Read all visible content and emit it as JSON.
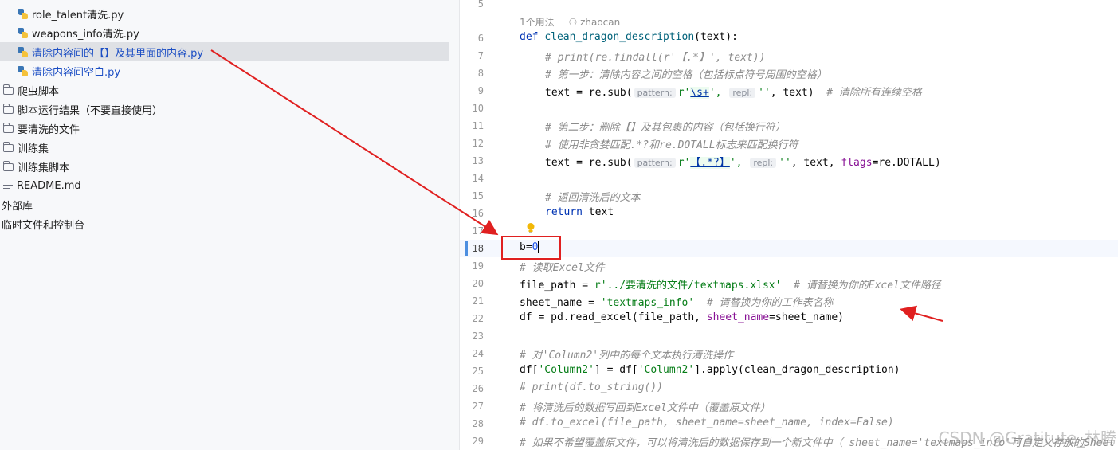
{
  "project_tree": {
    "files_top": [
      {
        "label": "role_talent清洗.py",
        "type": "python"
      },
      {
        "label": "weapons_info清洗.py",
        "type": "python"
      },
      {
        "label": "清除内容间的【】及其里面的内容.py",
        "type": "python",
        "selected": true
      },
      {
        "label": "清除内容间空白.py",
        "type": "python"
      }
    ],
    "folders": [
      {
        "label": "爬虫脚本"
      },
      {
        "label": "脚本运行结果（不要直接使用）"
      },
      {
        "label": "要清洗的文件"
      },
      {
        "label": "训练集"
      },
      {
        "label": "训练集脚本"
      }
    ],
    "readme": "README.md",
    "external_libs": "外部库",
    "scratches": "临时文件和控制台"
  },
  "editor": {
    "usage_hint": "1个用法",
    "author_hint": "zhaocan",
    "line_numbers": [
      "5",
      "6",
      "7",
      "8",
      "9",
      "10",
      "11",
      "12",
      "13",
      "14",
      "15",
      "16",
      "17",
      "18",
      "19",
      "20",
      "21",
      "22",
      "23",
      "24",
      "25",
      "26",
      "27",
      "28",
      "29"
    ],
    "current_line": "18",
    "hints": {
      "pattern": "pattern:",
      "repl": "repl:"
    },
    "code": {
      "l6_def": "def",
      "l6_name": "clean_dragon_description",
      "l6_rest": "(text):",
      "l7": "# print(re.findall(r'【.*】', text))",
      "l8": "# 第一步：清除内容之间的空格（包括标点符号周围的空格）",
      "l9_a": "text = re.sub(",
      "l9_s1a": "r'",
      "l9_rx": "\\s+",
      "l9_s1b": "',",
      "l9_s2": "''",
      "l9_b": ", text)",
      "l9_cm": "# 清除所有连续空格",
      "l11": "# 第二步：删除【】及其包裹的内容（包括换行符）",
      "l12": "# 使用非贪婪匹配.*?和re.DOTALL标志来匹配换行符",
      "l13_a": "text = re.sub(",
      "l13_s1a": "r'",
      "l13_rx": "【.*?】",
      "l13_s1b": "',",
      "l13_s2": "''",
      "l13_b": ", text, ",
      "l13_kw": "flags",
      "l13_c": "=re.DOTALL)",
      "l15": "# 返回清洗后的文本",
      "l16_kw": "return",
      "l16_rest": " text",
      "l18_a": "b=",
      "l18_num": "0",
      "l19": "# 读取Excel文件",
      "l20_a": "file_path = ",
      "l20_s": "r'../要清洗的文件/textmaps.xlsx'",
      "l20_cm": "# 请替换为你的Excel文件路径",
      "l21_a": "sheet_name = ",
      "l21_s": "'textmaps_info'",
      "l21_cm": "# 请替换为你的工作表名称",
      "l22_a": "df = pd.read_excel(file_path, ",
      "l22_kw": "sheet_name",
      "l22_b": "=sheet_name)",
      "l24": "# 对'Column2'列中的每个文本执行清洗操作",
      "l25_a": "df[",
      "l25_s1": "'Column2'",
      "l25_b": "] = df[",
      "l25_s2": "'Column2'",
      "l25_c": "].apply(clean_dragon_description)",
      "l26": "# print(df.to_string())",
      "l27": "# 将清洗后的数据写回到Excel文件中（覆盖原文件）",
      "l28": "# df.to_excel(file_path, sheet_name=sheet_name, index=False)",
      "l29": "# 如果不希望覆盖原文件，可以将清洗后的数据保存到一个新文件中（ sheet_name='textmaps_info'可自定义存放的Sheet"
    }
  },
  "watermark": "CSDN @Gratitute_林腾",
  "colors": {
    "annotation_red": "#e02020",
    "keyword": "#0033b3",
    "string": "#067d17",
    "comment": "#8c8c8c"
  }
}
